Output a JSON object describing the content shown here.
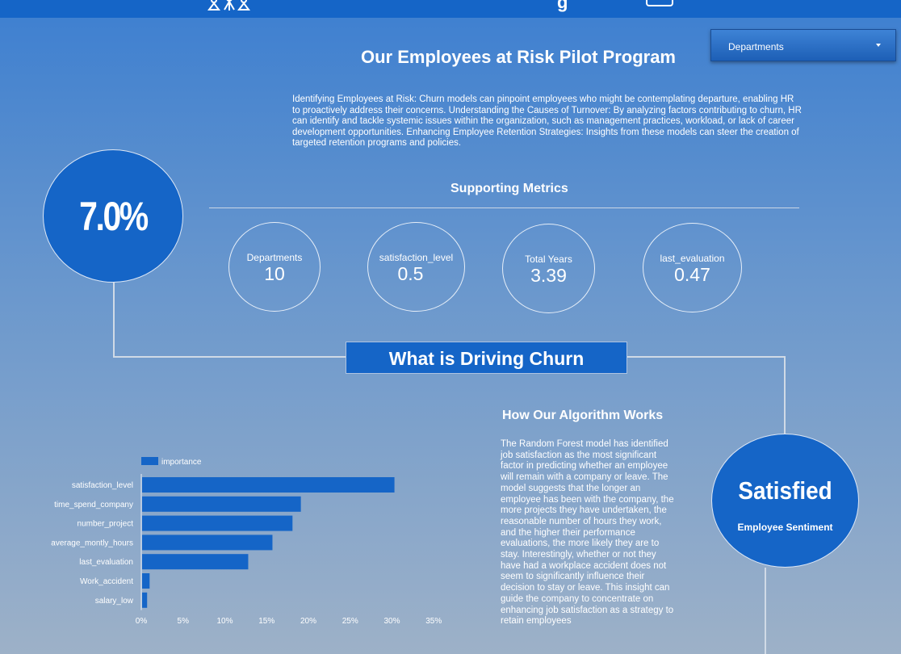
{
  "header": {
    "bar_color": "#1565c7",
    "icons": [
      "people-icon",
      "document-icon"
    ]
  },
  "filter": {
    "label": "Departments"
  },
  "main": {
    "title": "Our Employees at Risk Pilot Program",
    "intro": "Identifying Employees at Risk: Churn models can pinpoint employees who might be contemplating departure, enabling HR to proactively address their concerns. Understanding the Causes of Turnover: By analyzing factors contributing to churn, HR can identify and tackle systemic issues within the organization, such as management practices, workload, or lack of career development opportunities. Enhancing Employee Retention Strategies: Insights from these models can steer the creation of targeted retention programs and policies.",
    "churn_rate": "7.0%"
  },
  "metrics": {
    "title": "Supporting Metrics",
    "items": [
      {
        "label": "Departments",
        "value": "10"
      },
      {
        "label": "satisfaction_level",
        "value": "0.5"
      },
      {
        "label": "Total Years",
        "value": "3.39"
      },
      {
        "label": "last_evaluation",
        "value": "0.47"
      }
    ]
  },
  "driving": {
    "title": "What is Driving Churn"
  },
  "algorithm": {
    "title": "How Our Algorithm Works",
    "text": "The Random Forest model has identified job satisfaction as the most significant factor in predicting whether an employee will remain with a company or leave. The model suggests that the longer an employee has been with the company, the more projects they have undertaken, the reasonable number of hours they work, and the higher their performance evaluations, the more likely they are to stay. Interestingly, whether or not they have had a workplace accident does not seem to significantly influence their decision to stay or leave. This insight can guide the company to concentrate on enhancing job satisfaction as a strategy to retain employees"
  },
  "sentiment": {
    "value": "Satisfied",
    "label": "Employee Sentiment"
  },
  "colors": {
    "accent": "#1565c7",
    "bar": "#1565c7"
  },
  "chart_data": {
    "type": "bar",
    "orientation": "horizontal",
    "categories": [
      "satisfaction_level",
      "time_spend_company",
      "number_project",
      "average_montly_hours",
      "last_evaluation",
      "Work_accident",
      "salary_low"
    ],
    "series": [
      {
        "name": "importance",
        "values": [
          0.302,
          0.19,
          0.18,
          0.156,
          0.127,
          0.009,
          0.006
        ]
      }
    ],
    "xlim": [
      0,
      0.35
    ],
    "xticks": [
      "0%",
      "5%",
      "10%",
      "15%",
      "20%",
      "25%",
      "30%",
      "35%"
    ],
    "legend": "top-left",
    "grid": false
  }
}
